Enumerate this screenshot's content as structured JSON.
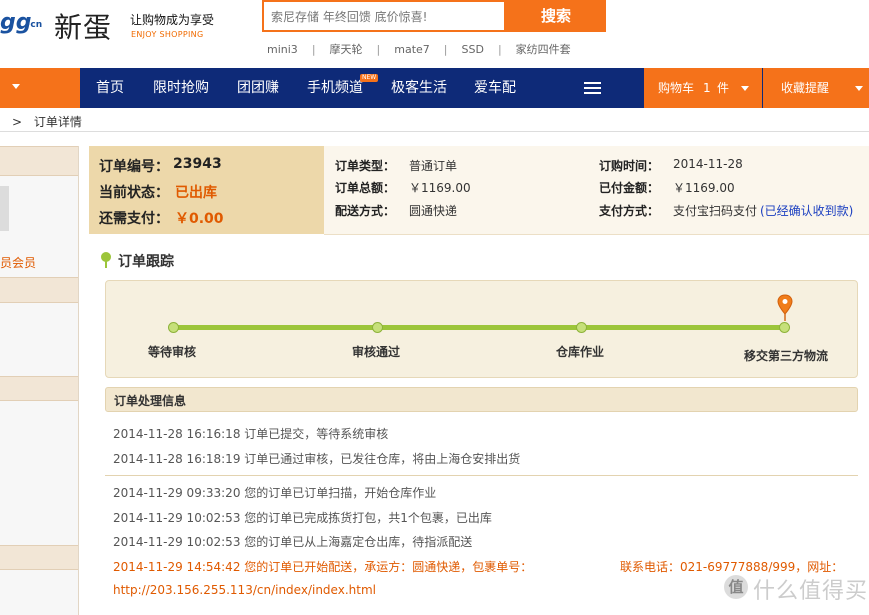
{
  "header": {
    "logo": {
      "egg": "gg",
      "cn": "·cn",
      "xindan": "新蛋",
      "tagline": "让购物成为享受",
      "tagline_en": "ENJOY SHOPPING"
    },
    "search": {
      "placeholder": "索尼存储 年终回馈 底价惊喜!",
      "button": "搜索"
    },
    "hot_words": [
      "mini3",
      "摩天轮",
      "mate7",
      "SSD",
      "家纺四件套"
    ],
    "hot_sep": "|"
  },
  "nav": {
    "items": [
      "首页",
      "限时抢购",
      "团团赚",
      "手机频道",
      "极客生活",
      "爱车配"
    ],
    "new_badge": "NEW",
    "cart_label": "购物车",
    "cart_count": "1",
    "cart_unit": "件",
    "favorites_label": "收藏提醒"
  },
  "breadcrumb": {
    "sep": ">",
    "current": "订单详情"
  },
  "sidebar": {
    "member_text": "员会员"
  },
  "order": {
    "number_label": "订单编号：",
    "number": "23943",
    "status_label": "当前状态：",
    "status": "已出库",
    "due_label": "还需支付：",
    "due": "￥0.00",
    "type_label": "订单类型：",
    "type": "普通订单",
    "time_label": "订购时间：",
    "time": "2014-11-28",
    "total_label": "订单总额：",
    "total": "￥1169.00",
    "paid_label": "已付金额：",
    "paid": "￥1169.00",
    "delivery_label": "配送方式：",
    "delivery": "圆通快递",
    "payment_label": "支付方式：",
    "payment": "支付宝扫码支付",
    "payment_note": "(已经确认收到款)"
  },
  "tracking": {
    "title": "订单跟踪",
    "steps": [
      "等待审核",
      "审核通过",
      "仓库作业",
      "移交第三方物流"
    ],
    "current_step": 4
  },
  "processing": {
    "title": "订单处理信息",
    "logs": [
      "2014-11-28 16:16:18 订单已提交，等待系统审核",
      "2014-11-28 16:18:19 订单已通过审核，已发往仓库，将由上海仓安排出货",
      "2014-11-29 09:33:20 您的订单已订单扫描，开始仓库作业",
      "2014-11-29 10:02:53 您的订单已完成拣货打包，共1个包裹，已出库",
      "2014-11-29 10:02:53 您的订单已从上海嘉定仓出库，待指派配送",
      "2014-11-29 14:54:42 您的订单已开始配送，承运方：圆通快递，包裹单号："
    ],
    "contact": "联系电话：021-69777888/999，网址：",
    "url": "http://203.156.255.113/cn/index/index.html"
  },
  "watermark": {
    "icon": "值",
    "text": "什么值得买"
  },
  "colors": {
    "accent": "#f5721a",
    "nav_bg": "#0e2a78",
    "status_red": "#e05a00",
    "progress": "#9cc53a"
  }
}
